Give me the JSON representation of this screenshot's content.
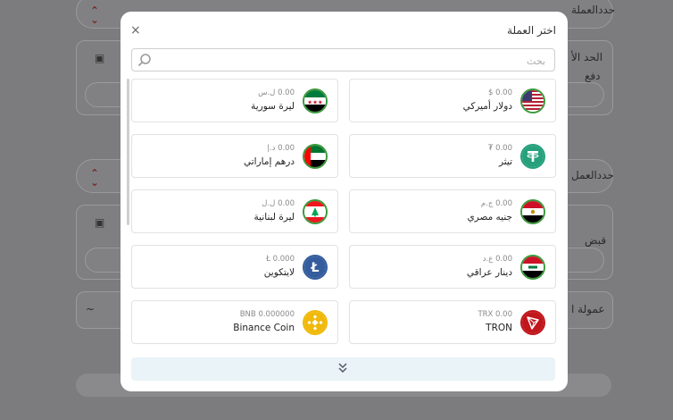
{
  "background": {
    "labels": [
      "حددالعملة",
      "الحد الأ",
      "دفع",
      "حددالعمل",
      "قبض",
      "عمولة ا"
    ],
    "tilde": "~"
  },
  "modal": {
    "title": "اختر العملة",
    "close_glyph": "×",
    "search_placeholder": "بحث",
    "currencies": [
      {
        "name": "دولار أميركي",
        "balance": "0.00 $",
        "icon": "usa-flag-icon"
      },
      {
        "name": "ليرة سورية",
        "balance": "0.00 ل.س",
        "icon": "syria-flag-icon"
      },
      {
        "name": "تيثر",
        "balance": "0.00 ₮",
        "icon": "tether-icon"
      },
      {
        "name": "درهم إماراتي",
        "balance": "0.00 د.إ",
        "icon": "uae-flag-icon"
      },
      {
        "name": "جنيه مصري",
        "balance": "0.00 ج.م",
        "icon": "egypt-flag-icon"
      },
      {
        "name": "ليرة لبنانية",
        "balance": "0.00 ل.ل",
        "icon": "lebanon-flag-icon"
      },
      {
        "name": "دينار عراقي",
        "balance": "0.00 ع.د",
        "icon": "iraq-flag-icon"
      },
      {
        "name": "لايتكوين",
        "balance": "0.000 Ł",
        "icon": "litecoin-icon"
      },
      {
        "name": "TRON",
        "balance": "TRX 0.00",
        "icon": "tron-icon"
      },
      {
        "name": "Binance Coin",
        "balance": "BNB 0.000000",
        "icon": "binance-coin-icon"
      }
    ]
  },
  "colors": {
    "accent_red": "#c0161c",
    "tether": "#26a17b",
    "litecoin": "#345d9d",
    "binance": "#f0b90b",
    "tron": "#c0161c"
  }
}
